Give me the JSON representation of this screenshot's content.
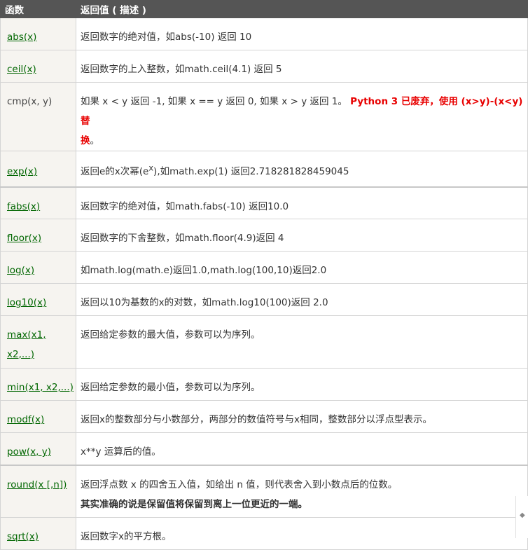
{
  "header": {
    "col1": "函数",
    "col2": "返回值 ( 描述 )"
  },
  "rows": [
    {
      "fn": "abs(x)",
      "desc": "返回数字的绝对值，如abs(-10) 返回 10"
    },
    {
      "fn": "ceil(x)",
      "desc": "返回数字的上入整数，如math.ceil(4.1) 返回 5"
    },
    {
      "fn": "cmp(x, y)",
      "desc": "如果 x < y 返回 -1, 如果 x == y 返回 0, 如果 x > y 返回 1。",
      "note_line1": "Python 3 已废弃，使用 (x>y)-(x<y) 替",
      "note_line2": "换",
      "note_tail": "。"
    },
    {
      "fn": "exp(x)",
      "desc_pre": "返回e的x次幂(e",
      "desc_sup": "x",
      "desc_post": "),如math.exp(1) 返回2.718281828459045"
    },
    {
      "fn": "fabs(x)",
      "desc": "返回数字的绝对值，如math.fabs(-10) 返回10.0"
    },
    {
      "fn": "floor(x)",
      "desc": "返回数字的下舍整数，如math.floor(4.9)返回 4"
    },
    {
      "fn": "log(x)",
      "desc": "如math.log(math.e)返回1.0,math.log(100,10)返回2.0"
    },
    {
      "fn": "log10(x)",
      "desc": "返回以10为基数的x的对数，如math.log10(100)返回 2.0"
    },
    {
      "fn_line1": "max(x1,",
      "fn_line2": "x2,...)",
      "desc": "返回给定参数的最大值，参数可以为序列。"
    },
    {
      "fn": "min(x1, x2,...)",
      "desc": "返回给定参数的最小值，参数可以为序列。"
    },
    {
      "fn": "modf(x)",
      "desc": "返回x的整数部分与小数部分，两部分的数值符号与x相同，整数部分以浮点型表示。"
    },
    {
      "fn": "pow(x, y)",
      "desc": "x**y 运算后的值。"
    },
    {
      "fn": "round(x [,n])",
      "desc": "返回浮点数 x 的四舍五入值，如给出 n 值，则代表舍入到小数点后的位数。",
      "note": "其实准确的说是保留值将保留到离上一位更近的一端。"
    },
    {
      "fn": "sqrt(x)",
      "desc": "返回数字x的平方根。"
    }
  ],
  "colors": {
    "header_bg": "#555555",
    "link": "#006600",
    "note_red": "#e80000",
    "fn_bg": "#f6f4f0"
  }
}
